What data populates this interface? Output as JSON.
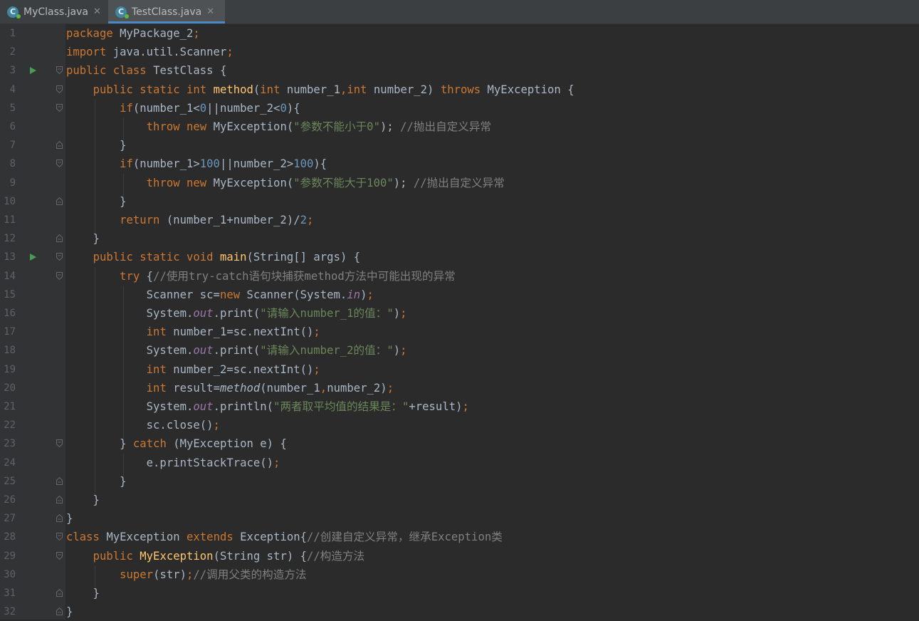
{
  "tabs": [
    {
      "label": "MyClass.java",
      "icon": "java-class-icon",
      "active": false
    },
    {
      "label": "TestClass.java",
      "icon": "java-class-icon",
      "active": true
    }
  ],
  "editor": {
    "colors": {
      "background": "#2b2b2b",
      "keyword": "#cc7832",
      "number": "#6897bb",
      "string": "#6a8759",
      "comment": "#808080",
      "method_decl": "#ffc66d",
      "static_field": "#9876aa",
      "default": "#a9b7c6"
    },
    "lines": [
      {
        "n": "1",
        "run": false,
        "fold": "none",
        "tokens": [
          [
            "kw",
            "package "
          ],
          [
            "",
            "MyPackage_2"
          ],
          [
            "kw",
            ";"
          ]
        ]
      },
      {
        "n": "2",
        "run": false,
        "fold": "none",
        "tokens": [
          [
            "kw",
            "import "
          ],
          [
            "",
            "java.util.Scanner"
          ],
          [
            "kw",
            ";"
          ]
        ]
      },
      {
        "n": "3",
        "run": true,
        "fold": "open",
        "tokens": [
          [
            "kw",
            "public class "
          ],
          [
            "",
            "TestClass {"
          ]
        ]
      },
      {
        "n": "4",
        "run": false,
        "fold": "open",
        "tokens": [
          [
            "",
            "    "
          ],
          [
            "kw",
            "public static int "
          ],
          [
            "fn",
            "method"
          ],
          [
            "",
            "("
          ],
          [
            "kw",
            "int "
          ],
          [
            "",
            "number_1"
          ],
          [
            "kw",
            ","
          ],
          [
            "kw",
            "int "
          ],
          [
            "",
            "number_2) "
          ],
          [
            "kw",
            "throws "
          ],
          [
            "",
            "MyException {"
          ]
        ]
      },
      {
        "n": "5",
        "run": false,
        "fold": "open",
        "tokens": [
          [
            "",
            "        "
          ],
          [
            "kw",
            "if"
          ],
          [
            "",
            "(number_1<"
          ],
          [
            "num",
            "0"
          ],
          [
            "",
            "||number_2<"
          ],
          [
            "num",
            "0"
          ],
          [
            "",
            "){"
          ]
        ]
      },
      {
        "n": "6",
        "run": false,
        "fold": "none",
        "tokens": [
          [
            "",
            "            "
          ],
          [
            "kw",
            "throw new "
          ],
          [
            "",
            "MyException("
          ],
          [
            "str",
            "\"参数不能小于0\""
          ],
          [
            "",
            "); "
          ],
          [
            "cmt",
            "//抛出自定义异常"
          ]
        ]
      },
      {
        "n": "7",
        "run": false,
        "fold": "close",
        "tokens": [
          [
            "",
            "        }"
          ]
        ]
      },
      {
        "n": "8",
        "run": false,
        "fold": "open",
        "tokens": [
          [
            "",
            "        "
          ],
          [
            "kw",
            "if"
          ],
          [
            "",
            "(number_1>"
          ],
          [
            "num",
            "100"
          ],
          [
            "",
            "||number_2>"
          ],
          [
            "num",
            "100"
          ],
          [
            "",
            "){"
          ]
        ]
      },
      {
        "n": "9",
        "run": false,
        "fold": "none",
        "tokens": [
          [
            "",
            "            "
          ],
          [
            "kw",
            "throw new "
          ],
          [
            "",
            "MyException("
          ],
          [
            "str",
            "\"参数不能大于100\""
          ],
          [
            "",
            "); "
          ],
          [
            "cmt",
            "//抛出自定义异常"
          ]
        ]
      },
      {
        "n": "10",
        "run": false,
        "fold": "close",
        "tokens": [
          [
            "",
            "        }"
          ]
        ]
      },
      {
        "n": "11",
        "run": false,
        "fold": "none",
        "tokens": [
          [
            "",
            "        "
          ],
          [
            "kw",
            "return "
          ],
          [
            "",
            "(number_1+number_2)/"
          ],
          [
            "num",
            "2"
          ],
          [
            "kw",
            ";"
          ]
        ]
      },
      {
        "n": "12",
        "run": false,
        "fold": "close",
        "tokens": [
          [
            "",
            "    }"
          ]
        ]
      },
      {
        "n": "13",
        "run": true,
        "fold": "open",
        "tokens": [
          [
            "",
            "    "
          ],
          [
            "kw",
            "public static void "
          ],
          [
            "fn",
            "main"
          ],
          [
            "",
            "(String[] args) {"
          ]
        ]
      },
      {
        "n": "14",
        "run": false,
        "fold": "open",
        "tokens": [
          [
            "",
            "        "
          ],
          [
            "kw",
            "try "
          ],
          [
            "",
            "{"
          ],
          [
            "cmt",
            "//使用try-catch语句块捕获method方法中可能出现的异常"
          ]
        ]
      },
      {
        "n": "15",
        "run": false,
        "fold": "none",
        "tokens": [
          [
            "",
            "            Scanner sc="
          ],
          [
            "kw",
            "new "
          ],
          [
            "",
            "Scanner(System."
          ],
          [
            "stat",
            "in"
          ],
          [
            "",
            ")"
          ],
          [
            "kw",
            ";"
          ]
        ]
      },
      {
        "n": "16",
        "run": false,
        "fold": "none",
        "tokens": [
          [
            "",
            "            System."
          ],
          [
            "stat",
            "out"
          ],
          [
            "",
            ".print("
          ],
          [
            "str",
            "\"请输入number_1的值：\""
          ],
          [
            "",
            ")"
          ],
          [
            "kw",
            ";"
          ]
        ]
      },
      {
        "n": "17",
        "run": false,
        "fold": "none",
        "tokens": [
          [
            "",
            "            "
          ],
          [
            "kw",
            "int "
          ],
          [
            "",
            "number_1=sc.nextInt()"
          ],
          [
            "kw",
            ";"
          ]
        ]
      },
      {
        "n": "18",
        "run": false,
        "fold": "none",
        "tokens": [
          [
            "",
            "            System."
          ],
          [
            "stat",
            "out"
          ],
          [
            "",
            ".print("
          ],
          [
            "str",
            "\"请输入number_2的值：\""
          ],
          [
            "",
            ")"
          ],
          [
            "kw",
            ";"
          ]
        ]
      },
      {
        "n": "19",
        "run": false,
        "fold": "none",
        "tokens": [
          [
            "",
            "            "
          ],
          [
            "kw",
            "int "
          ],
          [
            "",
            "number_2=sc.nextInt()"
          ],
          [
            "kw",
            ";"
          ]
        ]
      },
      {
        "n": "20",
        "run": false,
        "fold": "none",
        "tokens": [
          [
            "",
            "            "
          ],
          [
            "kw",
            "int "
          ],
          [
            "",
            "result="
          ],
          [
            "itl",
            "method"
          ],
          [
            "",
            "(number_1"
          ],
          [
            "kw",
            ","
          ],
          [
            "",
            "number_2)"
          ],
          [
            "kw",
            ";"
          ]
        ]
      },
      {
        "n": "21",
        "run": false,
        "fold": "none",
        "tokens": [
          [
            "",
            "            System."
          ],
          [
            "stat",
            "out"
          ],
          [
            "",
            ".println("
          ],
          [
            "str",
            "\"两者取平均值的结果是：\""
          ],
          [
            "",
            "+result)"
          ],
          [
            "kw",
            ";"
          ]
        ]
      },
      {
        "n": "22",
        "run": false,
        "fold": "none",
        "tokens": [
          [
            "",
            "            sc.close()"
          ],
          [
            "kw",
            ";"
          ]
        ]
      },
      {
        "n": "23",
        "run": false,
        "fold": "open",
        "tokens": [
          [
            "",
            "        } "
          ],
          [
            "kw",
            "catch "
          ],
          [
            "",
            "(MyException e) {"
          ]
        ]
      },
      {
        "n": "24",
        "run": false,
        "fold": "none",
        "tokens": [
          [
            "",
            "            e.printStackTrace()"
          ],
          [
            "kw",
            ";"
          ]
        ]
      },
      {
        "n": "25",
        "run": false,
        "fold": "close",
        "tokens": [
          [
            "",
            "        }"
          ]
        ]
      },
      {
        "n": "26",
        "run": false,
        "fold": "close",
        "tokens": [
          [
            "",
            "    }"
          ]
        ]
      },
      {
        "n": "27",
        "run": false,
        "fold": "close",
        "tokens": [
          [
            "",
            "}"
          ]
        ]
      },
      {
        "n": "28",
        "run": false,
        "fold": "open",
        "tokens": [
          [
            "kw",
            "class "
          ],
          [
            "",
            "MyException "
          ],
          [
            "kw",
            "extends "
          ],
          [
            "",
            "Exception{"
          ],
          [
            "cmt",
            "//创建自定义异常，继承Exception类"
          ]
        ]
      },
      {
        "n": "29",
        "run": false,
        "fold": "open",
        "tokens": [
          [
            "",
            "    "
          ],
          [
            "kw",
            "public "
          ],
          [
            "fn",
            "MyException"
          ],
          [
            "",
            "(String str) {"
          ],
          [
            "cmt",
            "//构造方法"
          ]
        ]
      },
      {
        "n": "30",
        "run": false,
        "fold": "none",
        "tokens": [
          [
            "",
            "        "
          ],
          [
            "kw",
            "super"
          ],
          [
            "",
            "(str)"
          ],
          [
            "kw",
            ";"
          ],
          [
            "cmt",
            "//调用父类的构造方法"
          ]
        ]
      },
      {
        "n": "31",
        "run": false,
        "fold": "close",
        "tokens": [
          [
            "",
            "    }"
          ]
        ]
      },
      {
        "n": "32",
        "run": false,
        "fold": "close",
        "tokens": [
          [
            "",
            "}"
          ]
        ]
      }
    ]
  }
}
